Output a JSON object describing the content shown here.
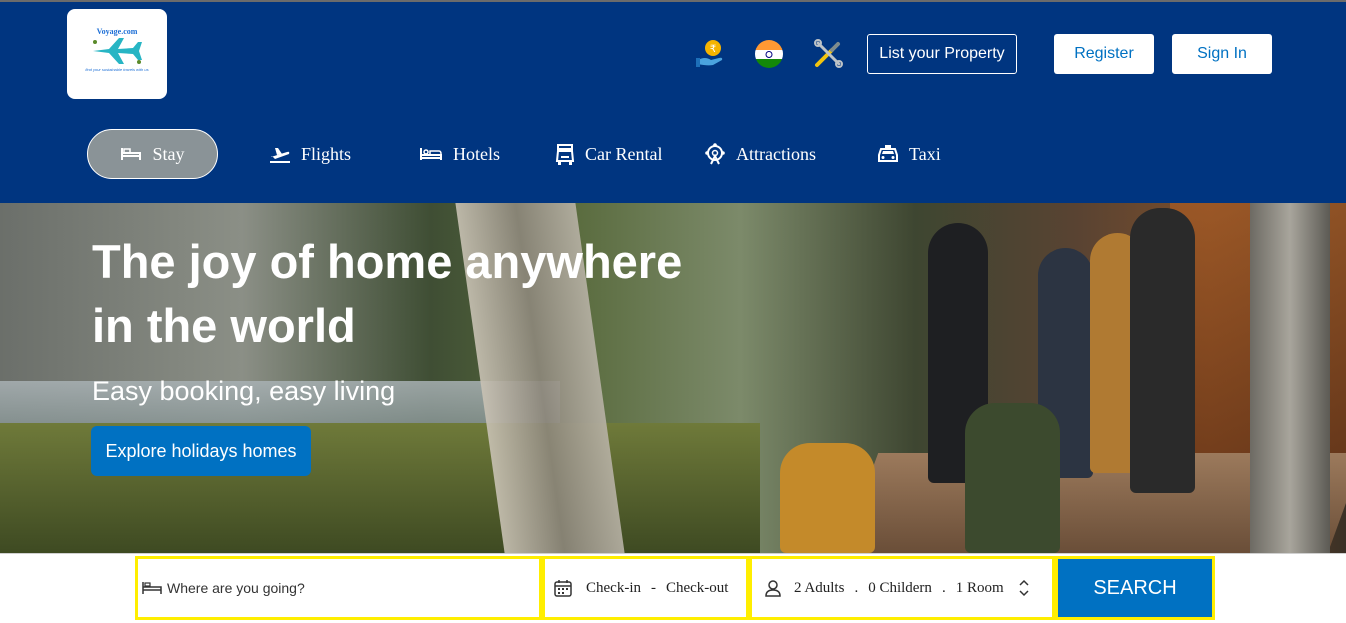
{
  "brand": {
    "name": "Voyage.com",
    "tagline": "find your sustainable travels with us"
  },
  "header": {
    "list_property_label": "List your Property",
    "register_label": "Register",
    "signin_label": "Sign In",
    "icons": [
      "currency-rupee-icon",
      "india-flag-icon",
      "tools-icon"
    ]
  },
  "nav": {
    "items": [
      {
        "label": "Stay",
        "icon": "bed-icon",
        "active": true
      },
      {
        "label": "Flights",
        "icon": "plane-icon"
      },
      {
        "label": "Hotels",
        "icon": "hotel-bed-icon"
      },
      {
        "label": "Car Rental",
        "icon": "car-rental-icon"
      },
      {
        "label": "Attractions",
        "icon": "ferris-wheel-icon"
      },
      {
        "label": "Taxi",
        "icon": "taxi-icon"
      }
    ]
  },
  "hero": {
    "title_line1": "The joy of home anywhere",
    "title_line2": "in the world",
    "subtitle": "Easy booking, easy living",
    "cta_label": "Explore holidays homes"
  },
  "search": {
    "destination_placeholder": "Where are you going?",
    "checkin_label": "Check-in",
    "date_separator": "-",
    "checkout_label": "Check-out",
    "adults_label": "2 Adults",
    "children_label": "0 Childern",
    "rooms_label": "1 Room",
    "guest_separator": ".",
    "search_label": "SEARCH"
  },
  "colors": {
    "header_bg": "#003580",
    "primary_button": "#0071c2",
    "highlight_border": "#ffee00",
    "active_tab_bg": "#8a9397"
  }
}
